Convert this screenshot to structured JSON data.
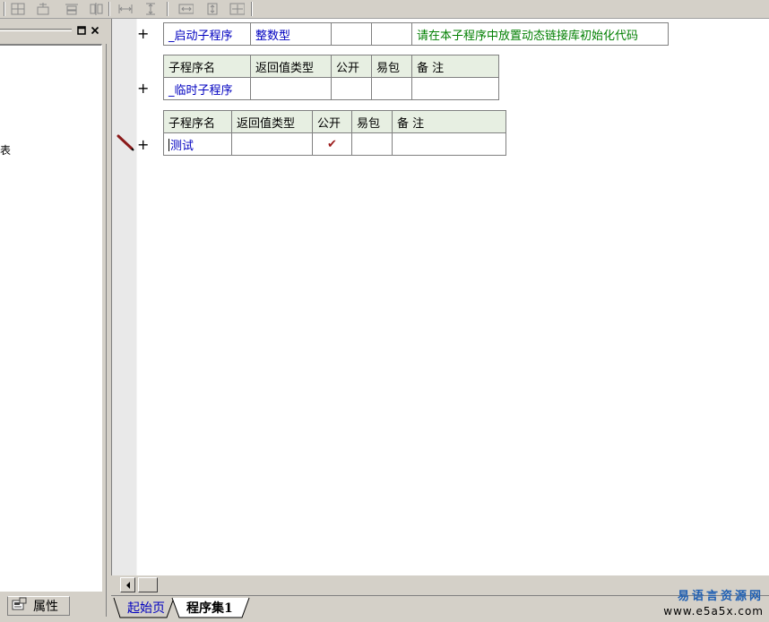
{
  "toolbar": {
    "buttons": [
      "align-left-icon",
      "align-center-icon",
      "align-top-icon",
      "align-bottom-icon",
      "same-width-icon",
      "same-height-icon",
      "h-space-icon",
      "v-space-icon",
      "center-both-icon"
    ]
  },
  "left_panel": {
    "stub_text": "表",
    "tab_label": "属性"
  },
  "editor": {
    "table1": {
      "row": [
        "_启动子程序",
        "整数型",
        "",
        "",
        "请在本子程序中放置动态链接库初始化代码"
      ]
    },
    "table2": {
      "headers": [
        "子程序名",
        "返回值类型",
        "公开",
        "易包",
        "备 注"
      ],
      "row": [
        "_临时子程序",
        "",
        "",
        "",
        ""
      ]
    },
    "table3": {
      "headers": [
        "子程序名",
        "返回值类型",
        "公开",
        "易包",
        "备 注"
      ],
      "row": [
        "测试",
        "",
        "✔",
        "",
        ""
      ]
    },
    "plus_symbol": "+"
  },
  "tabs": {
    "items": [
      "起始页",
      "程序集1"
    ]
  },
  "watermark": {
    "line1": "易语言资源网",
    "line2": "www.e5a5x.com"
  },
  "colors": {
    "header_bg": "#e7efe2",
    "link_blue": "#0000c0",
    "comment_green": "#007f00",
    "check_red": "#9c1b1b"
  }
}
